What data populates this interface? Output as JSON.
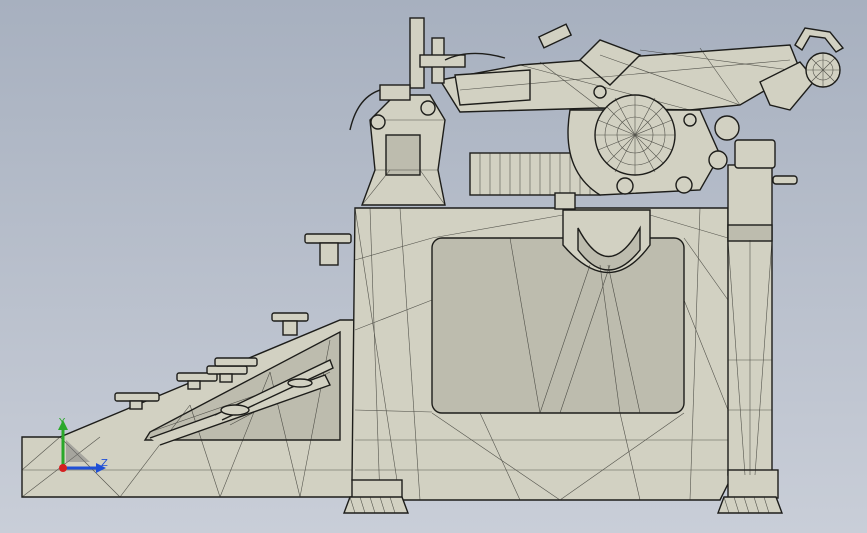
{
  "viewport": {
    "background_top": "#a7b0bf",
    "background_bottom": "#c9ced8",
    "model_fill": "#d2d1c2",
    "edge_color": "#1d1d1a"
  },
  "triad": {
    "y_label": "Y",
    "z_label": "Z",
    "y_color": "#2aa82a",
    "z_color": "#1f4fd6",
    "origin_color": "#d42020"
  }
}
